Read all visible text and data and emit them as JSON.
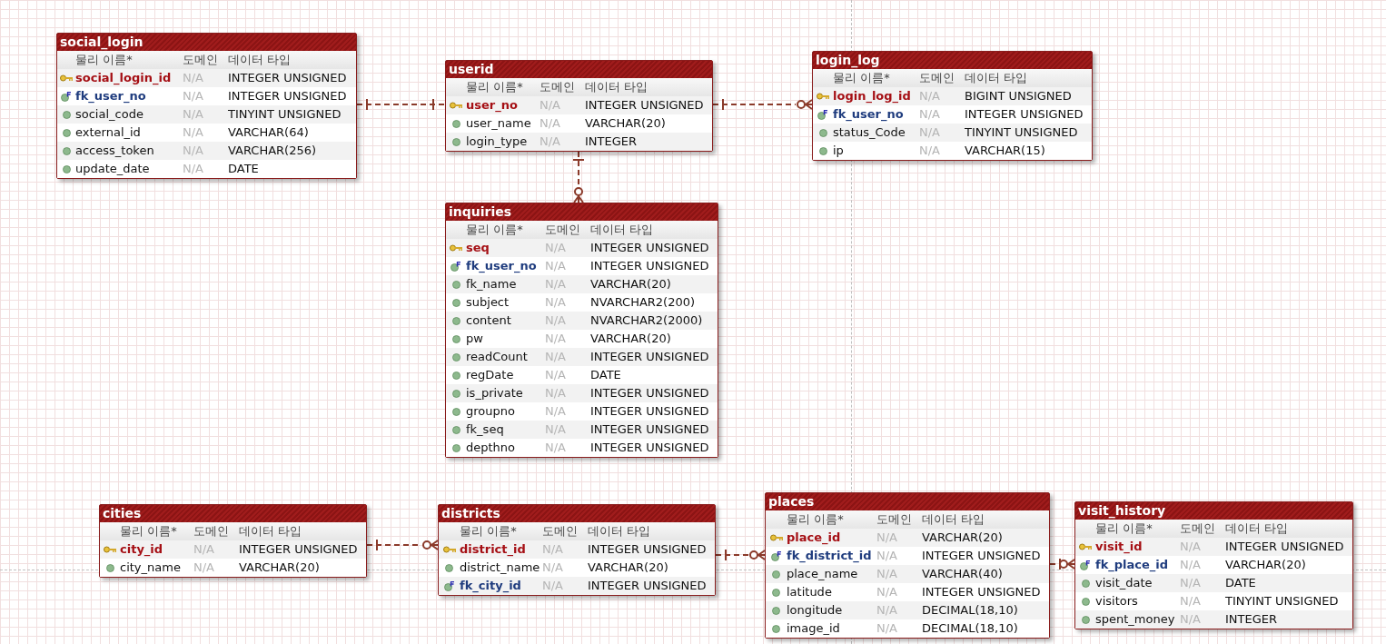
{
  "tables": [
    {
      "name": "social_login",
      "header": [
        "물리 이름*",
        "도메인",
        "데이터 타입"
      ],
      "fields": [
        {
          "kind": "pk",
          "name": "social_login_id",
          "domain": "N/A",
          "type": "INTEGER UNSIGNED"
        },
        {
          "kind": "fk",
          "name": "fk_user_no",
          "domain": "N/A",
          "type": "INTEGER UNSIGNED"
        },
        {
          "kind": "attr",
          "name": "social_code",
          "domain": "N/A",
          "type": "TINYINT UNSIGNED"
        },
        {
          "kind": "attr",
          "name": "external_id",
          "domain": "N/A",
          "type": "VARCHAR(64)"
        },
        {
          "kind": "attr",
          "name": "access_token",
          "domain": "N/A",
          "type": "VARCHAR(256)"
        },
        {
          "kind": "attr",
          "name": "update_date",
          "domain": "N/A",
          "type": "DATE"
        }
      ]
    },
    {
      "name": "userid",
      "header": [
        "물리 이름*",
        "도메인",
        "데이터 타입"
      ],
      "fields": [
        {
          "kind": "pk",
          "name": "user_no",
          "domain": "N/A",
          "type": "INTEGER UNSIGNED"
        },
        {
          "kind": "attr",
          "name": "user_name",
          "domain": "N/A",
          "type": "VARCHAR(20)"
        },
        {
          "kind": "attr",
          "name": "login_type",
          "domain": "N/A",
          "type": "INTEGER"
        }
      ]
    },
    {
      "name": "login_log",
      "header": [
        "물리 이름*",
        "도메인",
        "데이터 타입"
      ],
      "fields": [
        {
          "kind": "pk",
          "name": "login_log_id",
          "domain": "N/A",
          "type": "BIGINT UNSIGNED"
        },
        {
          "kind": "fk",
          "name": "fk_user_no",
          "domain": "N/A",
          "type": "INTEGER UNSIGNED"
        },
        {
          "kind": "attr",
          "name": "status_Code",
          "domain": "N/A",
          "type": "TINYINT UNSIGNED"
        },
        {
          "kind": "attr",
          "name": "ip",
          "domain": "N/A",
          "type": "VARCHAR(15)"
        }
      ]
    },
    {
      "name": "inquiries",
      "header": [
        "물리 이름*",
        "도메인",
        "데이터 타입"
      ],
      "fields": [
        {
          "kind": "pk",
          "name": "seq",
          "domain": "N/A",
          "type": "INTEGER UNSIGNED"
        },
        {
          "kind": "fk",
          "name": "fk_user_no",
          "domain": "N/A",
          "type": "INTEGER UNSIGNED"
        },
        {
          "kind": "attr",
          "name": "fk_name",
          "domain": "N/A",
          "type": "VARCHAR(20)"
        },
        {
          "kind": "attr",
          "name": "subject",
          "domain": "N/A",
          "type": "NVARCHAR2(200)"
        },
        {
          "kind": "attr",
          "name": "content",
          "domain": "N/A",
          "type": "NVARCHAR2(2000)"
        },
        {
          "kind": "attr",
          "name": "pw",
          "domain": "N/A",
          "type": "VARCHAR(20)"
        },
        {
          "kind": "attr",
          "name": "readCount",
          "domain": "N/A",
          "type": "INTEGER UNSIGNED"
        },
        {
          "kind": "attr",
          "name": "regDate",
          "domain": "N/A",
          "type": "DATE"
        },
        {
          "kind": "attr",
          "name": "is_private",
          "domain": "N/A",
          "type": "INTEGER UNSIGNED"
        },
        {
          "kind": "attr",
          "name": "groupno",
          "domain": "N/A",
          "type": "INTEGER UNSIGNED"
        },
        {
          "kind": "attr",
          "name": "fk_seq",
          "domain": "N/A",
          "type": "INTEGER UNSIGNED"
        },
        {
          "kind": "attr",
          "name": "depthno",
          "domain": "N/A",
          "type": "INTEGER UNSIGNED"
        }
      ]
    },
    {
      "name": "cities",
      "header": [
        "물리 이름*",
        "도메인",
        "데이터 타입"
      ],
      "fields": [
        {
          "kind": "pk",
          "name": "city_id",
          "domain": "N/A",
          "type": "INTEGER UNSIGNED"
        },
        {
          "kind": "attr",
          "name": "city_name",
          "domain": "N/A",
          "type": "VARCHAR(20)"
        }
      ]
    },
    {
      "name": "districts",
      "header": [
        "물리 이름*",
        "도메인",
        "데이터 타입"
      ],
      "fields": [
        {
          "kind": "pk",
          "name": "district_id",
          "domain": "N/A",
          "type": "INTEGER UNSIGNED"
        },
        {
          "kind": "attr",
          "name": "district_name",
          "domain": "N/A",
          "type": "VARCHAR(20)"
        },
        {
          "kind": "fk",
          "name": "fk_city_id",
          "domain": "N/A",
          "type": "INTEGER UNSIGNED"
        }
      ]
    },
    {
      "name": "places",
      "header": [
        "물리 이름*",
        "도메인",
        "데이터 타입"
      ],
      "fields": [
        {
          "kind": "pk",
          "name": "place_id",
          "domain": "N/A",
          "type": "VARCHAR(20)"
        },
        {
          "kind": "fk",
          "name": "fk_district_id",
          "domain": "N/A",
          "type": "INTEGER UNSIGNED"
        },
        {
          "kind": "attr",
          "name": "place_name",
          "domain": "N/A",
          "type": "VARCHAR(40)"
        },
        {
          "kind": "attr",
          "name": "latitude",
          "domain": "N/A",
          "type": "INTEGER UNSIGNED"
        },
        {
          "kind": "attr",
          "name": "longitude",
          "domain": "N/A",
          "type": "DECIMAL(18,10)"
        },
        {
          "kind": "attr",
          "name": "image_id",
          "domain": "N/A",
          "type": "DECIMAL(18,10)"
        }
      ]
    },
    {
      "name": "visit_history",
      "header": [
        "물리 이름*",
        "도메인",
        "데이터 타입"
      ],
      "fields": [
        {
          "kind": "pk",
          "name": "visit_id",
          "domain": "N/A",
          "type": "INTEGER UNSIGNED"
        },
        {
          "kind": "fk",
          "name": "fk_place_id",
          "domain": "N/A",
          "type": "VARCHAR(20)"
        },
        {
          "kind": "attr",
          "name": "visit_date",
          "domain": "N/A",
          "type": "DATE"
        },
        {
          "kind": "attr",
          "name": "visitors",
          "domain": "N/A",
          "type": "TINYINT UNSIGNED"
        },
        {
          "kind": "attr",
          "name": "spent_money",
          "domain": "N/A",
          "type": "INTEGER"
        }
      ]
    }
  ]
}
